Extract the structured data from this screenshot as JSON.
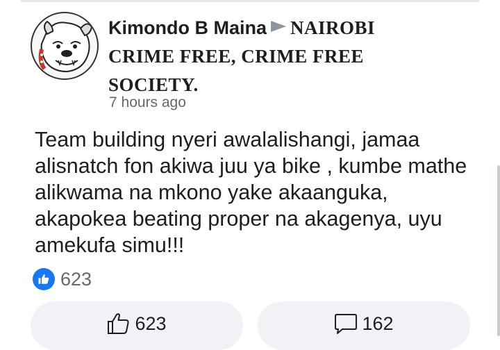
{
  "post": {
    "author": "Kimondo B Maina",
    "group_line1": "NAIROBI",
    "group_line2": "CRIME FREE, CRIME FREE",
    "group_line3": "SOCIETY.",
    "timestamp": "7 hours ago",
    "text": "Team building nyeri awalalishangi, jamaa alisnatch fon akiwa juu ya bike , kumbe mathe alikwama na mkono yake akaanguka, akapokea beating proper na akagenya, uyu amekufa simu!!!"
  },
  "reactions": {
    "icon": "like-icon",
    "count": "623"
  },
  "actions": {
    "like_count": "623",
    "like_icon": "thumbs-up-outline-icon",
    "comment_count": "162",
    "comment_icon": "comment-bubble-icon"
  },
  "colors": {
    "like_blue": "#1877f2",
    "muted_text": "#65676b",
    "button_bg": "#f0f2f5"
  }
}
